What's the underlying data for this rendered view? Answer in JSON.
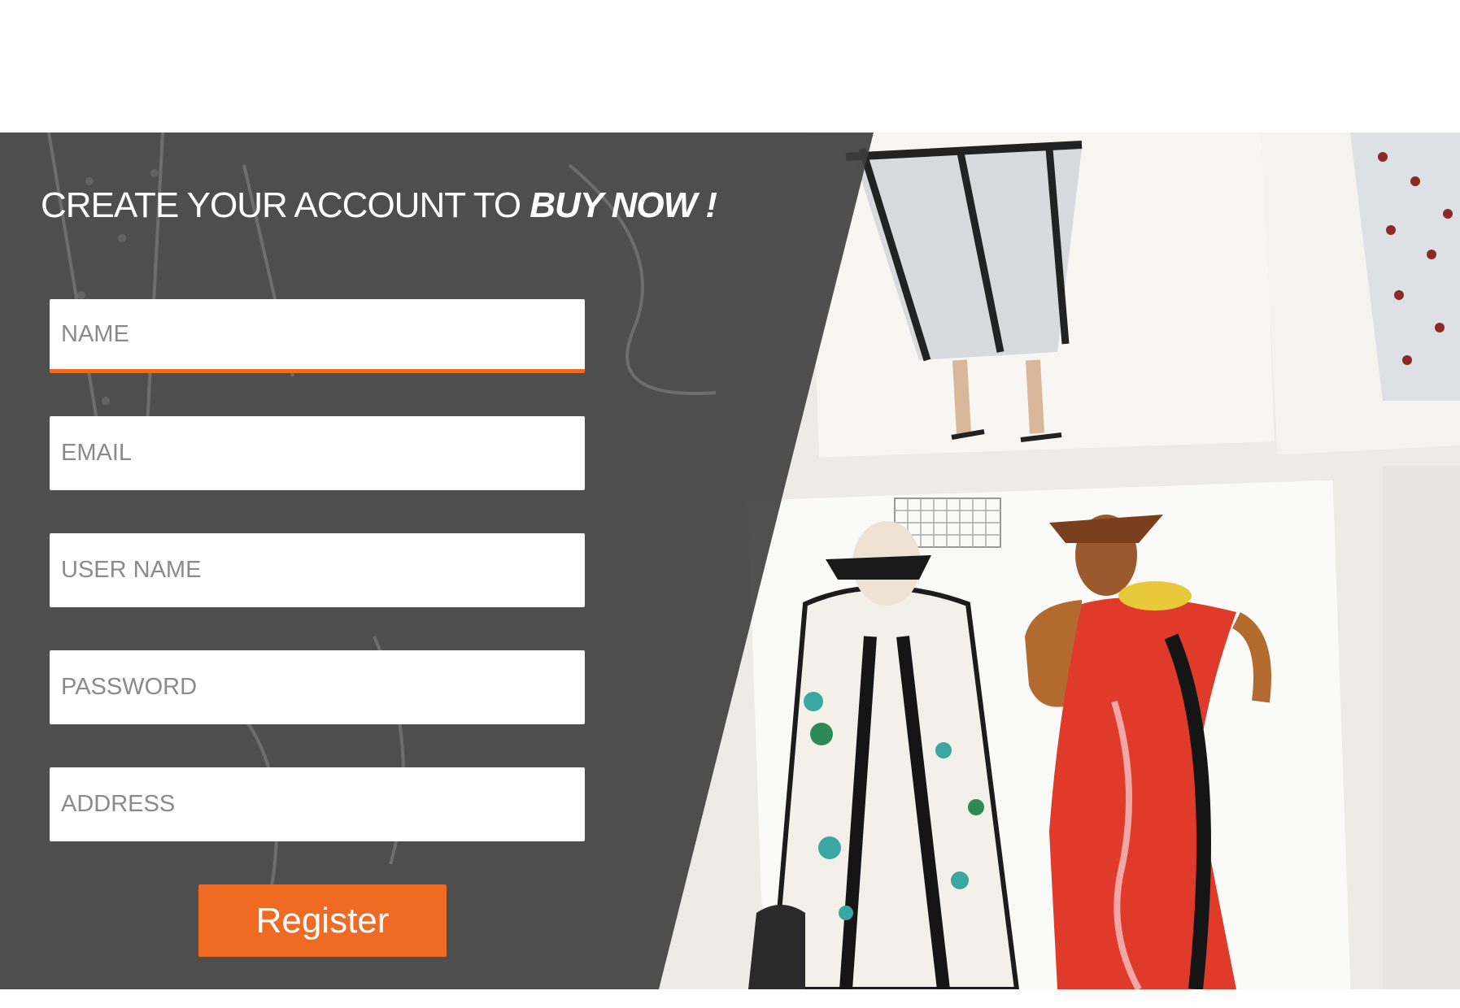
{
  "heading": {
    "text": "CREATE YOUR ACCOUNT TO ",
    "emphasis": "BUY NOW !"
  },
  "form": {
    "fields": [
      {
        "placeholder": "NAME",
        "active": true
      },
      {
        "placeholder": "EMAIL",
        "active": false
      },
      {
        "placeholder": "USER NAME",
        "active": false
      },
      {
        "placeholder": "PASSWORD",
        "active": false
      },
      {
        "placeholder": "ADDRESS",
        "active": false
      }
    ],
    "submit_label": "Register"
  },
  "colors": {
    "accent": "#ef6a23",
    "panel": "#3d3d3d",
    "field_background": "#ffffff",
    "placeholder_text": "#8a8a8a"
  },
  "image": {
    "subject": "watercolor fashion illustrations"
  }
}
